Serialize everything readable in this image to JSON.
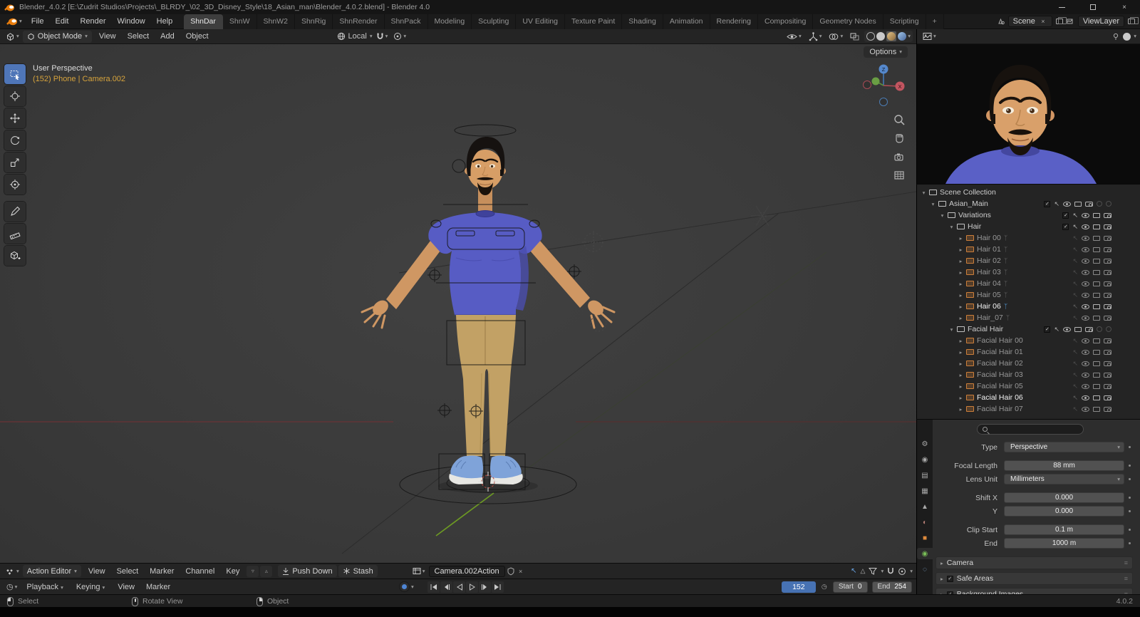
{
  "window": {
    "title": "Blender_4.0.2 [E:\\Zudrit Studios\\Projects\\_BLRDY_\\02_3D_Disney_Style\\18_Asian_man\\Blender_4.0.2.blend] - Blender 4.0"
  },
  "icons": {
    "chevron_down": "▾",
    "disclosure_open": "▾",
    "disclosure_closed": "▸",
    "close": "×",
    "check": "✓",
    "select_pointer": "↖",
    "timeline_clock": "◷",
    "armature_badge": "ᛉ",
    "grip": "≡",
    "plus": "+"
  },
  "topbar": {
    "menus": [
      {
        "label": "File",
        "name": "menu-file"
      },
      {
        "label": "Edit",
        "name": "menu-edit"
      },
      {
        "label": "Render",
        "name": "menu-render"
      },
      {
        "label": "Window",
        "name": "menu-window"
      },
      {
        "label": "Help",
        "name": "menu-help"
      }
    ],
    "workspaces": [
      {
        "label": "ShnDar",
        "name": "tab-shndar",
        "state": "active"
      },
      {
        "label": "ShnW",
        "name": "tab-shnw"
      },
      {
        "label": "ShnW2",
        "name": "tab-shnw2"
      },
      {
        "label": "ShnRig",
        "name": "tab-shnrig"
      },
      {
        "label": "ShnRender",
        "name": "tab-shnrender"
      },
      {
        "label": "ShnPack",
        "name": "tab-shnpack"
      },
      {
        "label": "Modeling",
        "name": "tab-modeling"
      },
      {
        "label": "Sculpting",
        "name": "tab-sculpting"
      },
      {
        "label": "UV Editing",
        "name": "tab-uv-editing"
      },
      {
        "label": "Texture Paint",
        "name": "tab-texture-paint"
      },
      {
        "label": "Shading",
        "name": "tab-shading"
      },
      {
        "label": "Animation",
        "name": "tab-animation"
      },
      {
        "label": "Rendering",
        "name": "tab-rendering"
      },
      {
        "label": "Compositing",
        "name": "tab-compositing"
      },
      {
        "label": "Geometry Nodes",
        "name": "tab-geometry-nodes"
      },
      {
        "label": "Scripting",
        "name": "tab-scripting"
      },
      {
        "label": "+",
        "name": "tab-new-workspace"
      }
    ],
    "scene_selector": "Scene",
    "viewlayer_selector": "ViewLayer"
  },
  "viewport": {
    "header": {
      "mode": "Object Mode",
      "menus": [
        {
          "label": "View",
          "name": "menu-view"
        },
        {
          "label": "Select",
          "name": "menu-select"
        },
        {
          "label": "Add",
          "name": "menu-add"
        },
        {
          "label": "Object",
          "name": "menu-object"
        }
      ],
      "orientation": "Local",
      "options": "Options"
    },
    "hud": {
      "line1": "User Perspective",
      "line2": "(152) Phone | Camera.002"
    },
    "gizmo": {
      "x": "X",
      "z": "Z"
    },
    "tools": [
      "select-box",
      "cursor",
      "move",
      "rotate",
      "scale",
      "transform",
      "annotate",
      "measure",
      "add-cube"
    ],
    "nav_icons": [
      "zoom",
      "pan-hand",
      "camera-view",
      "toggle-orthographic"
    ]
  },
  "outliner": {
    "rows": [
      {
        "label": "Scene Collection",
        "level": 0,
        "disc": "▾",
        "kind": "root",
        "name": "outliner-row-scene-collection"
      },
      {
        "label": "Asian_Main",
        "level": 1,
        "disc": "▾",
        "kind": "collection-x",
        "name": "outliner-row-asian-main"
      },
      {
        "label": "Variations",
        "level": 2,
        "disc": "▾",
        "kind": "collection",
        "name": "outliner-row-variations"
      },
      {
        "label": "Hair",
        "level": 3,
        "disc": "▾",
        "kind": "collection",
        "name": "outliner-row-hair"
      },
      {
        "label": "Hair 00",
        "level": 4,
        "disc": "▸",
        "kind": "object",
        "state": "dim",
        "badge": "ᛉ",
        "name": "outliner-row-hair-00"
      },
      {
        "label": "Hair 01",
        "level": 4,
        "disc": "▸",
        "kind": "object",
        "state": "dim",
        "badge": "ᛉ",
        "name": "outliner-row-hair-01"
      },
      {
        "label": "Hair 02",
        "level": 4,
        "disc": "▸",
        "kind": "object",
        "state": "dim",
        "badge": "ᛉ",
        "name": "outliner-row-hair-02"
      },
      {
        "label": "Hair 03",
        "level": 4,
        "disc": "▸",
        "kind": "object",
        "state": "dim",
        "badge": "ᛉ",
        "name": "outliner-row-hair-03"
      },
      {
        "label": "Hair 04",
        "level": 4,
        "disc": "▸",
        "kind": "object",
        "state": "dim",
        "badge": "ᛉ",
        "name": "outliner-row-hair-04"
      },
      {
        "label": "Hair 05",
        "level": 4,
        "disc": "▸",
        "kind": "object",
        "state": "dim",
        "badge": "ᛉ",
        "name": "outliner-row-hair-05"
      },
      {
        "label": "Hair 06",
        "level": 4,
        "disc": "▸",
        "kind": "object",
        "state": "bright",
        "badge": "ᛉ",
        "name": "outliner-row-hair-06"
      },
      {
        "label": "Hair_07",
        "level": 4,
        "disc": "▸",
        "kind": "object",
        "state": "dim",
        "badge": "ᛉ",
        "name": "outliner-row-hair-07"
      },
      {
        "label": "Facial Hair",
        "level": 3,
        "disc": "▾",
        "kind": "collection-x",
        "name": "outliner-row-facial-hair"
      },
      {
        "label": "Facial Hair 00",
        "level": 4,
        "disc": "▸",
        "kind": "object",
        "state": "dim",
        "name": "outliner-row-facial-hair-00"
      },
      {
        "label": "Facial Hair 01",
        "level": 4,
        "disc": "▸",
        "kind": "object",
        "state": "dim",
        "name": "outliner-row-facial-hair-01"
      },
      {
        "label": "Facial Hair 02",
        "level": 4,
        "disc": "▸",
        "kind": "object",
        "state": "dim",
        "name": "outliner-row-facial-hair-02"
      },
      {
        "label": "Facial Hair 03",
        "level": 4,
        "disc": "▸",
        "kind": "object",
        "state": "dim",
        "name": "outliner-row-facial-hair-03"
      },
      {
        "label": "Facial Hair 05",
        "level": 4,
        "disc": "▸",
        "kind": "object",
        "state": "dim",
        "name": "outliner-row-facial-hair-05"
      },
      {
        "label": "Facial Hair 06",
        "level": 4,
        "disc": "▸",
        "kind": "object",
        "state": "bright",
        "name": "outliner-row-facial-hair-06"
      },
      {
        "label": "Facial Hair 07",
        "level": 4,
        "disc": "▸",
        "kind": "object",
        "state": "dim",
        "name": "outliner-row-facial-hair-07"
      }
    ]
  },
  "properties": {
    "search_placeholder": "",
    "tabs": [
      {
        "name": "tab-tool",
        "glyph": "⚙",
        "color": "#a8a8a8"
      },
      {
        "name": "tab-render",
        "glyph": "◉",
        "color": "#a8a8a8"
      },
      {
        "name": "tab-output",
        "glyph": "▤",
        "color": "#a8a8a8"
      },
      {
        "name": "tab-view-layer",
        "glyph": "▦",
        "color": "#a8a8a8"
      },
      {
        "name": "tab-scene",
        "glyph": "▲",
        "color": "#a8a8a8"
      },
      {
        "name": "tab-world",
        "glyph": "◐",
        "color": "#b07a72"
      },
      {
        "name": "tab-object",
        "glyph": "■",
        "color": "#de8a3c"
      },
      {
        "name": "tab-object-data",
        "glyph": "◉",
        "color": "#79bd57",
        "state": "active"
      },
      {
        "name": "tab-physics",
        "glyph": "◌",
        "color": "#8cb6e0"
      }
    ],
    "rows": [
      {
        "label": "Type",
        "value": "Perspective",
        "kind": "dropdown",
        "name": "field-type"
      },
      {
        "label": "Focal Length",
        "value": "88 mm",
        "kind": "number",
        "state": "gap",
        "name": "field-focal-length"
      },
      {
        "label": "Lens Unit",
        "value": "Millimeters",
        "kind": "dropdown",
        "name": "field-lens-unit"
      },
      {
        "label": "Shift X",
        "value": "0.000",
        "kind": "number",
        "state": "gap",
        "name": "field-shift-x"
      },
      {
        "label": "Y",
        "value": "0.000",
        "kind": "number",
        "name": "field-shift-y"
      },
      {
        "label": "Clip Start",
        "value": "0.1 m",
        "kind": "number",
        "state": "gap",
        "name": "field-clip-start"
      },
      {
        "label": "End",
        "value": "1000 m",
        "kind": "number",
        "name": "field-clip-end"
      }
    ],
    "panels": [
      {
        "label": "Camera",
        "kind": "plain",
        "name": "panel-camera"
      },
      {
        "label": "Safe Areas",
        "kind": "chk",
        "name": "panel-safe-areas"
      },
      {
        "label": "Background Images",
        "kind": "chk",
        "name": "panel-background-images"
      }
    ]
  },
  "dopesheet": {
    "editor": "Action Editor",
    "menus": [
      {
        "label": "View",
        "name": "menu-view"
      },
      {
        "label": "Select",
        "name": "menu-select"
      },
      {
        "label": "Marker",
        "name": "menu-marker"
      },
      {
        "label": "Channel",
        "name": "menu-channel"
      },
      {
        "label": "Key",
        "name": "menu-key"
      }
    ],
    "push_down": "Push Down",
    "stash": "Stash",
    "action": "Camera.002Action"
  },
  "timeline": {
    "playback": "Playback",
    "keying": "Keying",
    "menus": [
      {
        "label": "View",
        "name": "menu-view"
      },
      {
        "label": "Marker",
        "name": "menu-marker"
      }
    ],
    "transport": [
      "jump-to-start",
      "previous-keyframe",
      "play-reverse",
      "play",
      "next-keyframe",
      "jump-to-end"
    ],
    "frame": "152",
    "start_label": "Start",
    "start": "0",
    "end_label": "End",
    "end": "254"
  },
  "statusbar": {
    "select": "Select",
    "rotate_view": "Rotate View",
    "object": "Object",
    "version": "4.0.2"
  }
}
